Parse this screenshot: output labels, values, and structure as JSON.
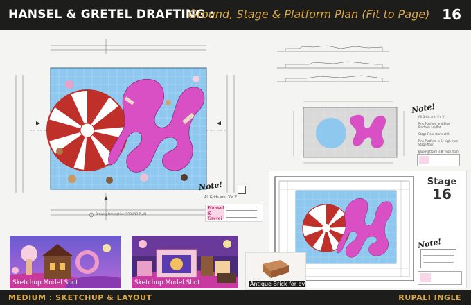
{
  "header": {
    "title_main": "HANSEL & GRETEL DRAFTING :",
    "title_sub": "Ground, Stage & Platform Plan (Fit to Page)",
    "page_number": "16"
  },
  "footer": {
    "medium": "MEDIUM : SKETCHUP & LAYOUT",
    "author": "RUPALI INGLE"
  },
  "plan_main": {
    "note_heading": "Note!",
    "note_text": "All Grids are: 3'x 3'",
    "drawing_caption": "Drawing Description: GROUND PLAN"
  },
  "title_block": {
    "show_title_line1": "Hansel",
    "show_title_line2": "& Gretel"
  },
  "plan_right": {
    "note_heading": "Note!",
    "note_lines": [
      "All Grids are: 3'x 3'",
      "Pink Platform and Blue Platform are flat.",
      "Stage Floor starts at 0",
      "Pink Platform is 6\" high from Stage floor.",
      "Blue Platform is 8\" high from Stage floor."
    ]
  },
  "plan_stage": {
    "stage_label": "Stage",
    "stage_number": "16",
    "note_heading": "Note!"
  },
  "thumbnails": [
    {
      "caption": "Sketchup Model Shot"
    },
    {
      "caption": "Sketchup Model Shot"
    },
    {
      "caption": "Antique Brick for oven"
    }
  ],
  "colors": {
    "header_bg": "#1d1d1b",
    "accent_gold": "#d9a84a",
    "stage_blue": "#8ec8ee",
    "platform_pink": "#d94fc4",
    "peppermint_red": "#c0302a"
  }
}
